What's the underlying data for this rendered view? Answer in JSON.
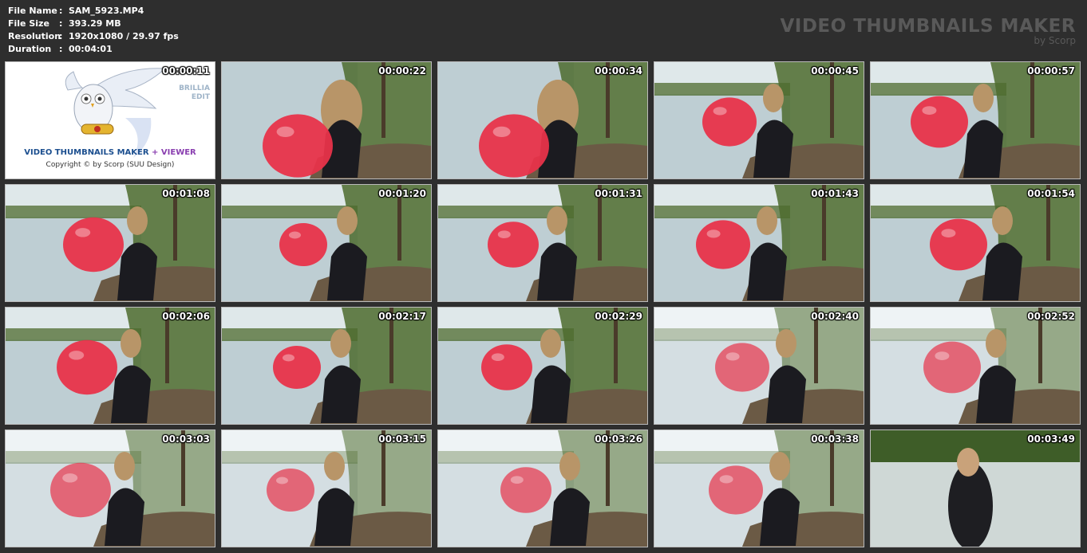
{
  "info": {
    "rows": [
      {
        "key": "File Name",
        "value": "SAM_5923.MP4"
      },
      {
        "key": "File Size",
        "value": "393.29 MB"
      },
      {
        "key": "Resolution",
        "value": "1920x1080 / 29.97 fps"
      },
      {
        "key": "Duration",
        "value": "00:04:01"
      }
    ],
    "separator": ":"
  },
  "brand": {
    "title": "VIDEO THUMBNAILS MAKER",
    "subtitle": "by Scorp"
  },
  "logo_tile": {
    "title_part1": "VIDEO THUMBNAILS MAKER",
    "title_part2": "+ VIEWER",
    "copyright": "Copyright © by Scorp (SUU Design)",
    "edition_line1": "BRILLIA",
    "edition_line2": "EDIT",
    "timestamp": "00:00:11"
  },
  "thumbnails": [
    {
      "time": "00:00:22",
      "scene": "closeup"
    },
    {
      "time": "00:00:34",
      "scene": "closeup"
    },
    {
      "time": "00:00:45",
      "scene": "lake"
    },
    {
      "time": "00:00:57",
      "scene": "lake"
    },
    {
      "time": "00:01:08",
      "scene": "lake"
    },
    {
      "time": "00:01:20",
      "scene": "lake"
    },
    {
      "time": "00:01:31",
      "scene": "lake"
    },
    {
      "time": "00:01:43",
      "scene": "lake"
    },
    {
      "time": "00:01:54",
      "scene": "lake"
    },
    {
      "time": "00:02:06",
      "scene": "lake"
    },
    {
      "time": "00:02:17",
      "scene": "lake"
    },
    {
      "time": "00:02:29",
      "scene": "lake"
    },
    {
      "time": "00:02:40",
      "scene": "bright"
    },
    {
      "time": "00:02:52",
      "scene": "bright"
    },
    {
      "time": "00:03:03",
      "scene": "bright"
    },
    {
      "time": "00:03:15",
      "scene": "bright"
    },
    {
      "time": "00:03:26",
      "scene": "bright"
    },
    {
      "time": "00:03:38",
      "scene": "bright"
    },
    {
      "time": "00:03:49",
      "scene": "standing"
    }
  ],
  "colors": {
    "background": "#2e2e2e",
    "balloon": "#e8334a",
    "water": "#b9c9cf",
    "foliage": "#4e6b2e",
    "ground": "#6b5a45",
    "logo_title_red": "#c0242b",
    "logo_title_blue": "#1c4f8f",
    "logo_title_purple": "#8a3fb0"
  }
}
